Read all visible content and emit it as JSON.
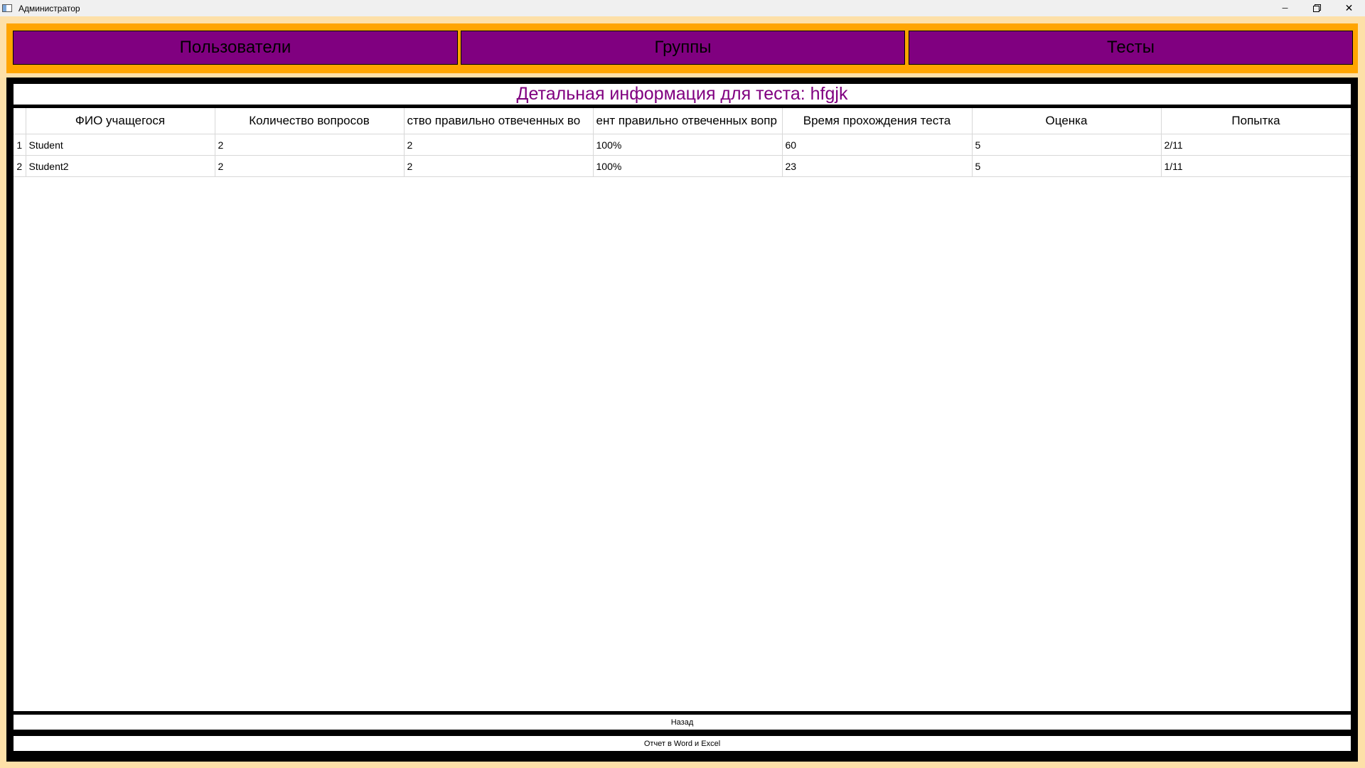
{
  "window": {
    "title": "Администратор",
    "minimize_glyph": "─",
    "restore_icon": "restore-icon",
    "close_glyph": "✕"
  },
  "nav": {
    "users": "Пользователи",
    "groups": "Группы",
    "tests": "Тесты"
  },
  "header": {
    "title": "Детальная информация для теста: hfgjk"
  },
  "table": {
    "columns": [
      "ФИО учащегося",
      "Количество вопросов",
      "ство правильно отвеченных во",
      "ент правильно отвеченных вопр",
      "Время прохождения теста",
      "Оценка",
      "Попытка"
    ],
    "rows": [
      {
        "num": "1",
        "cells": [
          "Student",
          "2",
          "2",
          "100%",
          "60",
          "5",
          "2/11"
        ]
      },
      {
        "num": "2",
        "cells": [
          "Student2",
          "2",
          "2",
          "100%",
          "23",
          "5",
          "1/11"
        ]
      }
    ]
  },
  "buttons": {
    "back": "Назад",
    "report": "Отчет в Word и Excel"
  },
  "colors": {
    "nav_bg": "#ffa500",
    "nav_button": "#800080",
    "frame_bg": "#fde0a8",
    "title_color": "#800080"
  }
}
